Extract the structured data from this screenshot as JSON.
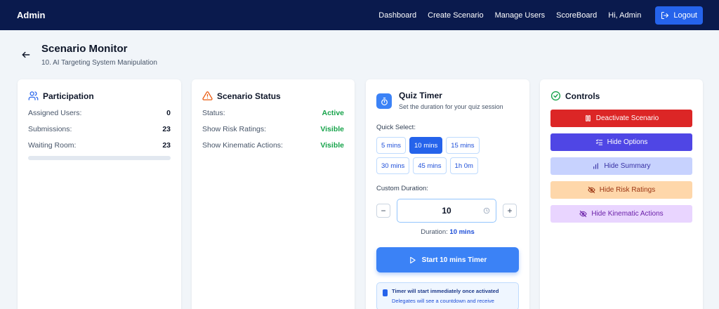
{
  "app": {
    "brand": "Admin"
  },
  "nav": {
    "items": [
      "Dashboard",
      "Create Scenario",
      "Manage Users",
      "ScoreBoard",
      "Hi, Admin"
    ],
    "logout_label": "Logout"
  },
  "page": {
    "title": "Scenario Monitor",
    "subtitle": "10. AI Targeting System Manipulation"
  },
  "participation": {
    "title": "Participation",
    "rows": [
      {
        "label": "Assigned Users:",
        "value": "0"
      },
      {
        "label": "Submissions:",
        "value": "23"
      },
      {
        "label": "Waiting Room:",
        "value": "23"
      }
    ]
  },
  "status": {
    "title": "Scenario Status",
    "rows": [
      {
        "label": "Status:",
        "value": "Active"
      },
      {
        "label": "Show Risk Ratings:",
        "value": "Visible"
      },
      {
        "label": "Show Kinematic Actions:",
        "value": "Visible"
      }
    ]
  },
  "timer": {
    "title": "Quiz Timer",
    "subtitle": "Set the duration for your quiz session",
    "quick_label": "Quick Select:",
    "chips": [
      "5 mins",
      "10 mins",
      "15 mins",
      "30 mins",
      "45 mins",
      "1h 0m"
    ],
    "selected_chip": "10 mins",
    "custom_label": "Custom Duration:",
    "custom_value": "10",
    "minus": "−",
    "plus": "+",
    "duration_prefix": "Duration:",
    "duration_value": "10 mins",
    "start_label": "Start 10 mins Timer",
    "notice_title": "Timer will start immediately once activated",
    "notice_text": "Delegates will see a countdown and receive"
  },
  "controls": {
    "title": "Controls",
    "buttons": [
      {
        "label": "Deactivate Scenario",
        "icon": "pause-icon",
        "bg": "#dc2626",
        "fg": "#ffffff"
      },
      {
        "label": "Hide Options",
        "icon": "list-check-icon",
        "bg": "#4f46e5",
        "fg": "#ffffff"
      },
      {
        "label": "Hide Summary",
        "icon": "bar-chart-icon",
        "bg": "#c7d2fe",
        "fg": "#3730a3"
      },
      {
        "label": "Hide Risk Ratings",
        "icon": "eye-off-icon",
        "bg": "#fed7aa",
        "fg": "#9a3412"
      },
      {
        "label": "Hide Kinematic Actions",
        "icon": "eye-off-icon",
        "bg": "#e9d5ff",
        "fg": "#6b21a8"
      }
    ]
  },
  "colors": {
    "navbar": "#0a1a4d",
    "accent": "#2563eb",
    "success": "#16a34a"
  }
}
